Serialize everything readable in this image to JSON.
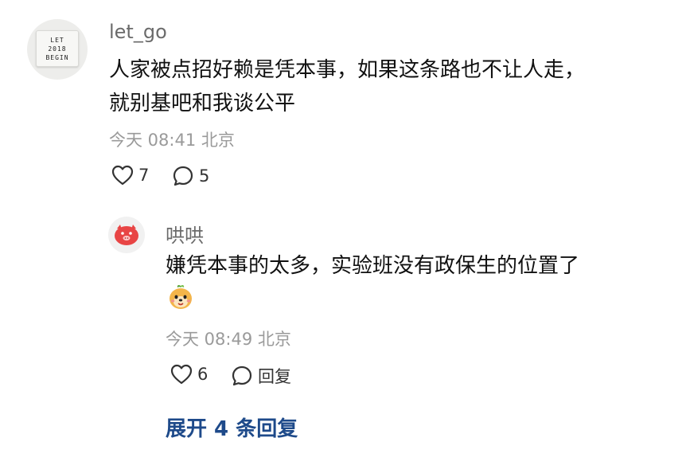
{
  "comment": {
    "avatar_text": [
      "LET",
      "2018",
      "BEGIN"
    ],
    "username": "let_go",
    "text_line1": "人家被点招好赖是凭本事，如果这条路也不让人走，",
    "text_line2": "就别基吧和我谈公平",
    "meta": "今天 08:41 北京",
    "likes": "7",
    "replies": "5"
  },
  "reply": {
    "username": "哄哄",
    "text": "嫌凭本事的太多，实验班没有政保生的位置了",
    "meta": "今天 08:49 北京",
    "likes": "6",
    "reply_label": "回复"
  },
  "expand_label": "展开 4 条回复",
  "colors": {
    "link": "#1e4a8a",
    "meta": "#9a9a9a",
    "avatar_pig": "#e84545"
  }
}
